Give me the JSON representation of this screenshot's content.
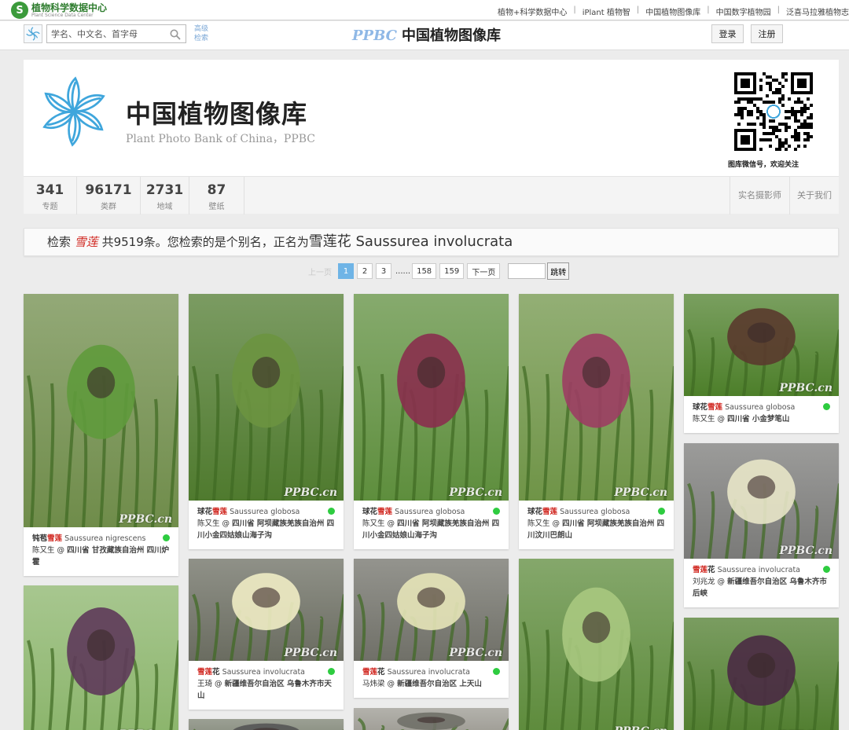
{
  "topbar": {
    "logo_cn": "植物科学数据中心",
    "logo_en": "Plant Science Data Center",
    "links": [
      "植物+科学数据中心",
      "iPlant 植物智",
      "中国植物图像库",
      "中国数字植物园",
      "泛喜马拉雅植物志"
    ]
  },
  "header": {
    "search_placeholder": "学名、中文名、首字母",
    "advanced_search": "高级检索",
    "brand_en": "PPBC",
    "brand_cn": "中国植物图像库",
    "login": "登录",
    "register": "注册"
  },
  "banner": {
    "title": "中国植物图像库",
    "subtitle": "Plant Photo Bank of China，PPBC",
    "qr_caption": "图库微信号，欢迎关注"
  },
  "stats": [
    {
      "num": "341",
      "label": "专题"
    },
    {
      "num": "96171",
      "label": "类群"
    },
    {
      "num": "2731",
      "label": "地域"
    },
    {
      "num": "87",
      "label": "壁纸"
    }
  ],
  "right_links": [
    "实名摄影师",
    "关于我们"
  ],
  "notice": {
    "prefix": "检索",
    "keyword": "雪莲",
    "middle": "共9519条。您检索的是个别名，正名为",
    "accepted_name": "雪莲花 Saussurea involucrata"
  },
  "pagination": {
    "prev": "上一页",
    "pages": [
      "1",
      "2",
      "3",
      "......",
      "158",
      "159"
    ],
    "current": "1",
    "next": "下一页",
    "jump": "跳转"
  },
  "watermark": "PPBC.cn",
  "cards": [
    {
      "cn_pre": "钝苞",
      "cn_hl": "雪莲",
      "cn_post": "",
      "latin": "Saussurea nigrescens",
      "author": "陈又生",
      "location": "四川省 甘孜藏族自治州 四川炉霍",
      "colors": [
        "#6f8c4a",
        "#5f9a3c"
      ]
    },
    {
      "cn_pre": "球花",
      "cn_hl": "雪莲",
      "cn_post": "",
      "latin": "Saussurea globosa",
      "author": "陈又生",
      "location": "四川省 阿坝藏族羌族自治州 四川小金四姑娘山海子沟",
      "colors": [
        "#4f7a2e",
        "#6c9440"
      ]
    },
    {
      "cn_pre": "球花",
      "cn_hl": "雪莲",
      "cn_post": "",
      "latin": "Saussurea globosa",
      "author": "陈又生",
      "location": "四川省 阿坝藏族羌族自治州 四川小金四姑娘山海子沟",
      "colors": [
        "#5e8e3d",
        "#8a2f4e"
      ]
    },
    {
      "cn_pre": "球花",
      "cn_hl": "雪莲",
      "cn_post": "",
      "latin": "Saussurea globosa",
      "author": "陈又生",
      "location": "四川省 阿坝藏族羌族自治州 四川汶川巴朗山",
      "colors": [
        "#6f9447",
        "#9c3d63"
      ]
    },
    {
      "cn_pre": "球花",
      "cn_hl": "雪莲",
      "cn_post": "",
      "latin": "Saussurea globosa",
      "author": "陈又生",
      "location": "四川省 小金梦笔山",
      "colors": [
        "#4d7f2a",
        "#5a3a2e"
      ]
    },
    {
      "cn_pre": "",
      "cn_hl": "雪莲",
      "cn_post": "花",
      "latin": "Saussurea involucrata",
      "author": "刘兆龙",
      "location": "新疆维吾尔自治区 乌鲁木齐市 后峡",
      "colors": [
        "#7a7a78",
        "#e8e6c8"
      ]
    },
    {
      "cn_pre": "",
      "cn_hl": "雪莲",
      "cn_post": "花",
      "latin": "Saussurea involucrata",
      "author": "王琦",
      "location": "新疆维吾尔自治区 乌鲁木齐市天山",
      "colors": [
        "#6a6c60",
        "#f0ecc4"
      ]
    },
    {
      "cn_pre": "",
      "cn_hl": "雪莲",
      "cn_post": "花",
      "latin": "Saussurea involucrata",
      "author": "马炜梁",
      "location": "新疆维吾尔自治区 上天山",
      "colors": [
        "#707068",
        "#e6e4b8"
      ]
    },
    {
      "colors": [
        "#8ab46a",
        "#5e3a5a"
      ]
    },
    {
      "colors": [
        "#5c8a3a",
        "#a8c880"
      ]
    },
    {
      "colors": [
        "#4e7c2c",
        "#4a2a44"
      ]
    },
    {
      "colors": [
        "#7a8070",
        "#555"
      ]
    },
    {
      "colors": [
        "#9a9890",
        "#707068"
      ]
    }
  ]
}
